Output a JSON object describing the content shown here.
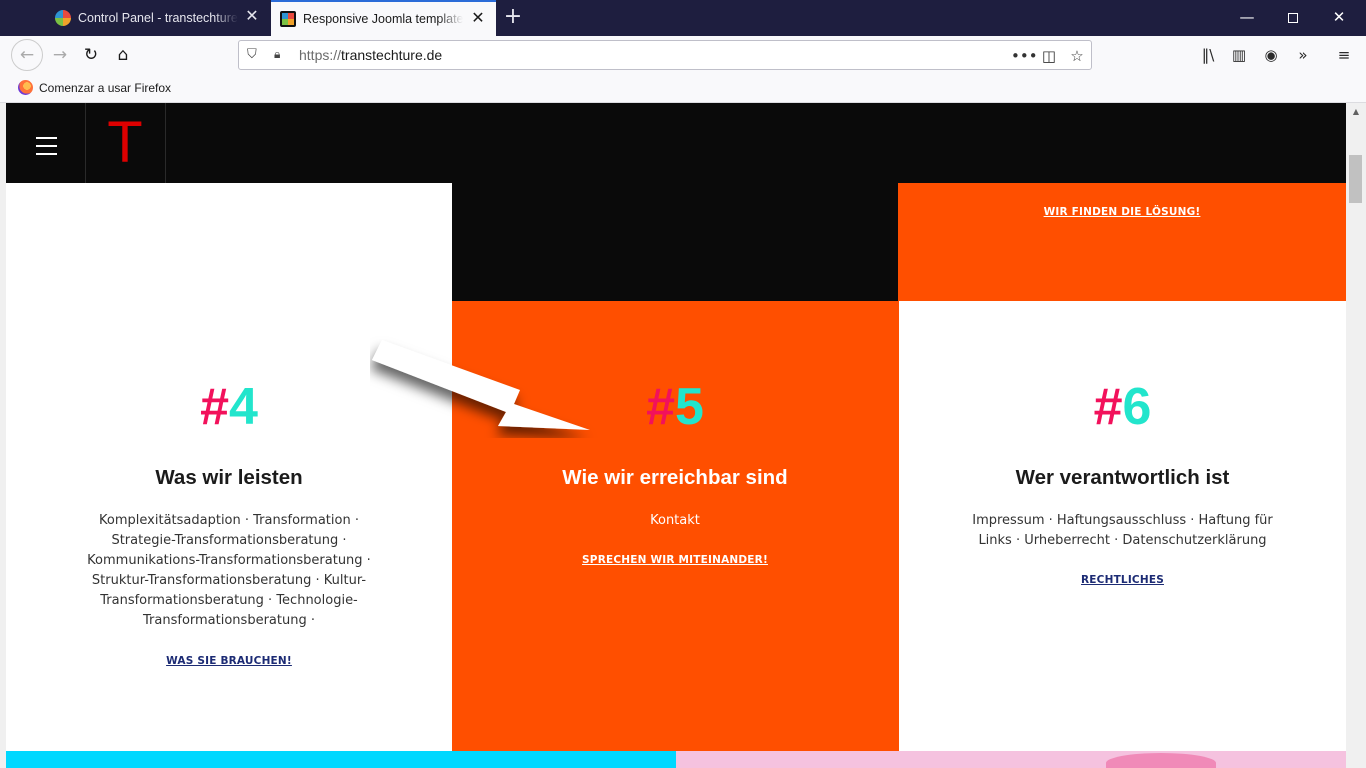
{
  "browser": {
    "tabs": [
      {
        "title": "Control Panel - transtechture.de",
        "active": false
      },
      {
        "title": "Responsive Joomla template fo",
        "active": true
      }
    ],
    "new_tab_icon": "plus-icon",
    "window_controls": [
      "minimize-icon",
      "maximize-icon",
      "close-icon"
    ],
    "url": {
      "protocol": "https://",
      "host": "transtechture.de"
    },
    "bookmark": "Comenzar a usar Firefox"
  },
  "site": {
    "logo": "T",
    "top_cta": "WIR FINDEN DIE LÖSUNG!",
    "columns": [
      {
        "hash": "#",
        "digit": "4",
        "heading": "Was wir leisten",
        "description": "Komplexitätsadaption · Transformation · Strategie-Transformationsberatung · Kommunikations-Transformationsberatung · Struktur-Transformationsberatung ·  Kultur-Transformationsberatung · Technologie-Transformationsberatung ·",
        "cta": "WAS SIE BRAUCHEN!"
      },
      {
        "hash": "#",
        "digit": "5",
        "heading": "Wie wir erreichbar sind",
        "description": "Kontakt",
        "cta": "SPRECHEN WIR MITEINANDER!"
      },
      {
        "hash": "#",
        "digit": "6",
        "heading": "Wer verantwortlich ist",
        "description": "Impressum · Haftungsausschluss · Haftung für Links · Urheberrecht ·  Datenschutzerklärung",
        "cta": "RECHTLICHES"
      }
    ],
    "colors": {
      "orange": "#ff4f00",
      "black": "#0a0a0a",
      "hash_pink": "#f2115b",
      "digit_teal": "#22e5cc",
      "link_navy": "#1c2b74",
      "strip_cyan": "#00d8ff",
      "strip_pink": "#f5c2df"
    }
  }
}
